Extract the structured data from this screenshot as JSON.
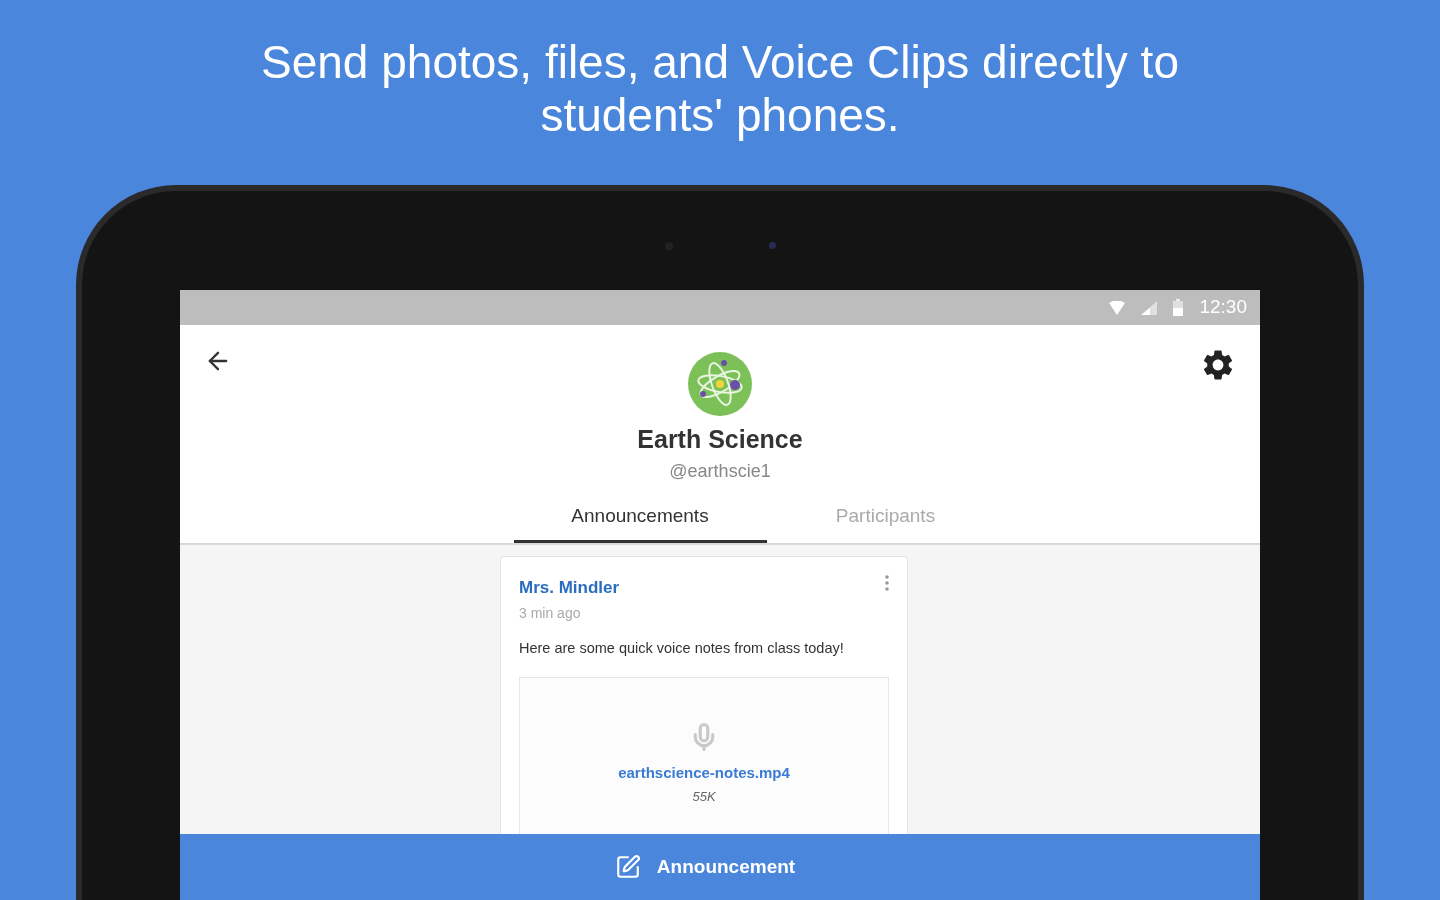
{
  "headline": "Send photos, files, and Voice Clips directly to students' phones.",
  "status_bar": {
    "time": "12:30"
  },
  "class": {
    "name": "Earth Science",
    "handle": "@earthscie1"
  },
  "tabs": [
    {
      "label": "Announcements",
      "selected": true
    },
    {
      "label": "Participants",
      "selected": false
    }
  ],
  "post": {
    "author": "Mrs. Mindler",
    "time": "3 min ago",
    "body": "Here are some quick voice notes from class today!",
    "attachment": {
      "filename": "earthscience-notes.mp4",
      "size": "55K"
    }
  },
  "compose_button": {
    "label": "Announcement"
  }
}
